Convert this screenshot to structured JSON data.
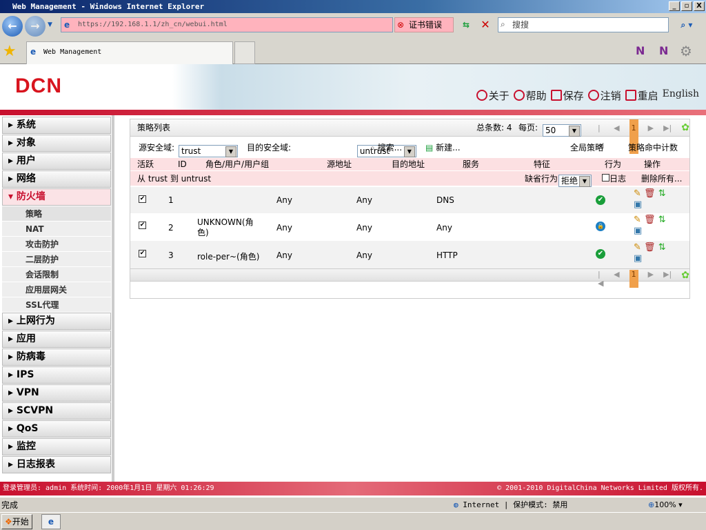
{
  "window": {
    "title": "Web Management - Windows Internet Explorer"
  },
  "browser": {
    "url": "https://192.168.1.1/zh_cn/webui.html",
    "cert_error": "证书错误",
    "search_placeholder": "搜搜",
    "tab_title": "Web Management"
  },
  "header": {
    "logo": "DCN",
    "links": [
      "关于",
      "帮助",
      "保存",
      "注销",
      "重启"
    ],
    "english": "English"
  },
  "sidebar": {
    "items": [
      "系统",
      "对象",
      "用户",
      "网络",
      "防火墙"
    ],
    "firewall_sub": [
      "策略",
      "NAT",
      "攻击防护",
      "二层防护",
      "会话限制",
      "应用层网关",
      "SSL代理"
    ],
    "items_after": [
      "上网行为",
      "应用",
      "防病毒",
      "IPS",
      "VPN",
      "SCVPN",
      "QoS",
      "监控",
      "日志报表"
    ]
  },
  "panel": {
    "title": "策略列表",
    "total_label": "总条数: 4",
    "per_page_label": "每页:",
    "per_page": "50",
    "page": "1",
    "src_zone_label": "源安全域:",
    "src_zone": "trust",
    "dst_zone_label": "目的安全域:",
    "dst_zone": "untrust",
    "search": "搜索...",
    "new": "新建...",
    "global_policy": "全局策略",
    "hit_count": "策略命中计数",
    "columns": [
      "活跃",
      "ID",
      "角色/用户/用户组",
      "源地址",
      "目的地址",
      "服务",
      "特征",
      "行为",
      "操作"
    ],
    "group_label": "从 trust 到 untrust",
    "default_action_label": "缺省行为",
    "default_action": "拒绝",
    "log_label": "日志",
    "delete_all": "删除所有...",
    "rows": [
      {
        "id": "1",
        "role": "",
        "src": "Any",
        "dst": "Any",
        "service": "DNS",
        "action": "permit"
      },
      {
        "id": "2",
        "role": "UNKNOWN(角色)",
        "src": "Any",
        "dst": "Any",
        "service": "Any",
        "action": "lock"
      },
      {
        "id": "3",
        "role": "role-per~(角色)",
        "src": "Any",
        "dst": "Any",
        "service": "HTTP",
        "action": "permit"
      }
    ]
  },
  "footer": {
    "left": "登录管理员: admin 系统时间: 2000年1月1日 星期六 01:26:29",
    "right": "© 2001-2010 DigitalChina Networks Limited 版权所有."
  },
  "statusbar": {
    "text": "完成",
    "zone": "Internet | 保护模式: 禁用",
    "zoom": "100%"
  },
  "taskbar": {
    "start": "开始"
  }
}
